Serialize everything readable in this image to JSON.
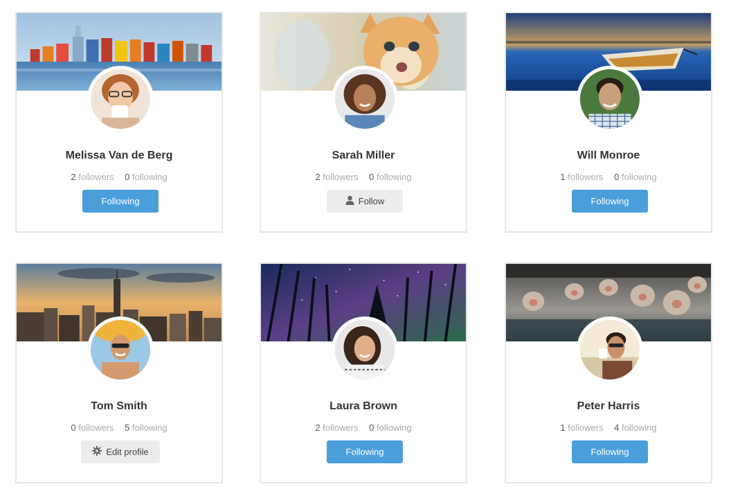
{
  "labels": {
    "followers": "followers",
    "following": "following"
  },
  "colors": {
    "primary_button": "#4a9fdb",
    "secondary_button": "#ececec",
    "card_border": "#e6e6e6"
  },
  "profiles": [
    {
      "name": "Melissa Van de Berg",
      "followers": "2",
      "following": "0",
      "button": "Following",
      "button_style": "primary",
      "cover": "colorful waterfront houses",
      "avatar": "woman with glasses drinking"
    },
    {
      "name": "Sarah Miller",
      "followers": "2",
      "following": "0",
      "button": "Follow",
      "button_style": "secondary",
      "button_icon": "user-icon",
      "cover": "orange kitten",
      "avatar": "smiling woman with curly hair"
    },
    {
      "name": "Will Monroe",
      "followers": "1",
      "following": "0",
      "button": "Following",
      "button_style": "primary",
      "cover": "boat on lake at dusk",
      "avatar": "man in checkered shirt"
    },
    {
      "name": "Tom Smith",
      "followers": "0",
      "following": "5",
      "button": "Edit profile",
      "button_style": "secondary",
      "button_icon": "gear-icon",
      "cover": "city skyline at sunset",
      "avatar": "man with surfboard"
    },
    {
      "name": "Laura Brown",
      "followers": "2",
      "following": "0",
      "button": "Following",
      "button_style": "primary",
      "cover": "starry night forest",
      "avatar": "smiling woman with dark hair"
    },
    {
      "name": "Peter Harris",
      "followers": "1",
      "following": "4",
      "button": "Following",
      "button_style": "primary",
      "cover": "snow monkeys in hot spring",
      "avatar": "man with sunglasses drinking coffee"
    }
  ]
}
